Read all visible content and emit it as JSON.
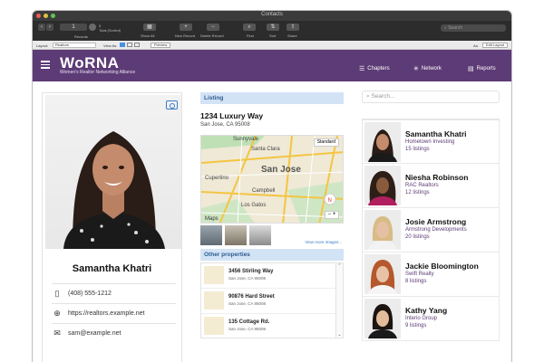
{
  "window": {
    "title": "Contacts"
  },
  "toolbar": {
    "record_number": "1",
    "total": "5",
    "total_label": "Total (Sorted)",
    "records_label": "Records",
    "show_all_label": "Show All",
    "new_record_label": "New Record",
    "delete_record_label": "Delete Record",
    "find_label": "Find",
    "sort_label": "Sort",
    "share_label": "Share",
    "search_placeholder": "Search"
  },
  "layoutbar": {
    "layout_label": "Layout:",
    "layout_value": "Realtors",
    "view_as_label": "View As:",
    "preview_label": "Preview",
    "aa_label": "Aa",
    "edit_layout_label": "Edit Layout"
  },
  "header": {
    "logo": "WoRNA",
    "tagline": "Women's Realtor Networking Alliance",
    "nav": [
      {
        "label": "Chapters",
        "icon": "list-icon"
      },
      {
        "label": "Network",
        "icon": "network-icon"
      },
      {
        "label": "Reports",
        "icon": "report-icon"
      }
    ]
  },
  "profile": {
    "name": "Samantha Khatri",
    "phone": "(408) 555-1212",
    "website": "https://realtors.example.net",
    "email": "sam@example.net"
  },
  "listing": {
    "section_label": "Listing",
    "address_line1": "1234 Luxury Way",
    "address_line2": "San Jose, CA 95008",
    "map_labels": {
      "standard": "Standard",
      "sunnyvale": "Sunnyvale",
      "santa_clara": "Santa Clara",
      "san_jose": "San Jose",
      "cupertino": "Cupertino",
      "campbell": "Campbell",
      "los_gatos": "Los Gatos",
      "maps": "Maps",
      "compass": "N"
    },
    "view_more": "View more images..."
  },
  "other_properties": {
    "section_label": "Other properties",
    "items": [
      {
        "street": "3456 Stirling Way",
        "city": "San Jose, CA 95008"
      },
      {
        "street": "90876 Hard Street",
        "city": "San Jose, CA 95008"
      },
      {
        "street": "135 Cottage Rd.",
        "city": "San Jose, CA 95008"
      }
    ]
  },
  "search": {
    "placeholder": "Search..."
  },
  "people": [
    {
      "name": "Samantha Khatri",
      "company": "Hometown Investing",
      "listings": "15 listings"
    },
    {
      "name": "Niesha Robinson",
      "company": "RAC Realtors",
      "listings": "12 listings"
    },
    {
      "name": "Josie Armstrong",
      "company": "Armstrong Developments",
      "listings": "20 listings"
    },
    {
      "name": "Jackie Bloomington",
      "company": "Swift Realty",
      "listings": "8 listings"
    },
    {
      "name": "Kathy Yang",
      "company": "Interio Group",
      "listings": "9 listings"
    }
  ],
  "colors": {
    "brand": "#5d3b76",
    "accent": "#3a7bc8",
    "section_bg": "#d3e3f6"
  }
}
